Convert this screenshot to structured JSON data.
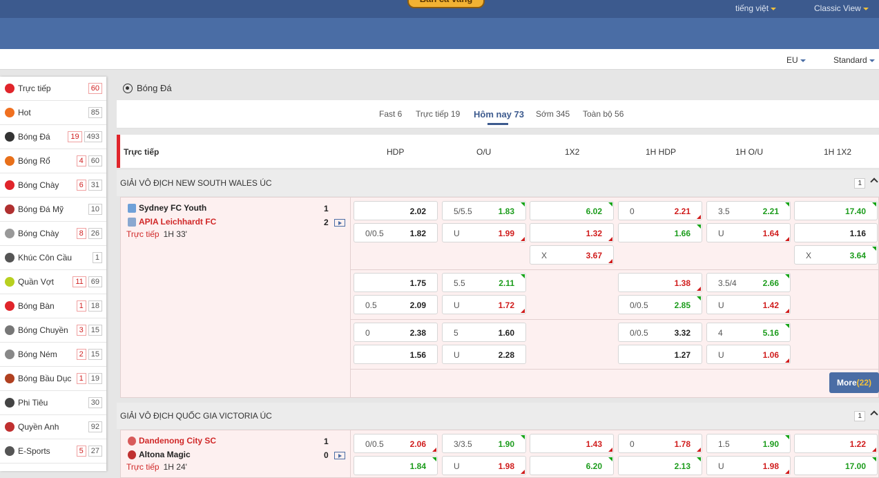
{
  "topbar": {
    "logo_text": "Bắn cá vàng",
    "language": "tiếng việt",
    "view_mode": "Classic View"
  },
  "subbar": {
    "odds_format": "EU",
    "display_mode": "Standard"
  },
  "sidebar": {
    "items": [
      {
        "icon": "live-icon",
        "label": "Trực tiếp",
        "live": "",
        "count": "60",
        "count_red": true,
        "color": "#e0252b"
      },
      {
        "icon": "fire-icon",
        "label": "Hot",
        "live": "",
        "count": "85",
        "color": "#f07020"
      },
      {
        "icon": "soccer-ball-icon",
        "label": "Bóng Đá",
        "live": "19",
        "count": "493",
        "color": "#333333"
      },
      {
        "icon": "basketball-icon",
        "label": "Bóng Rổ",
        "live": "4",
        "count": "60",
        "color": "#e8701a"
      },
      {
        "icon": "baseball-icon",
        "label": "Bóng Chày",
        "live": "6",
        "count": "31",
        "color": "#e0252b"
      },
      {
        "icon": "american-football-icon",
        "label": "Bóng Đá Mỹ",
        "live": "",
        "count": "10",
        "color": "#b03030"
      },
      {
        "icon": "baseball-white-icon",
        "label": "Bóng Chày",
        "live": "8",
        "count": "26",
        "color": "#999999"
      },
      {
        "icon": "hockey-stick-icon",
        "label": "Khúc Côn Cầu",
        "live": "",
        "count": "1",
        "color": "#555555"
      },
      {
        "icon": "tennis-ball-icon",
        "label": "Quần Vợt",
        "live": "11",
        "count": "69",
        "color": "#b8d020"
      },
      {
        "icon": "table-tennis-icon",
        "label": "Bóng Bàn",
        "live": "1",
        "count": "18",
        "color": "#e0252b"
      },
      {
        "icon": "volleyball-icon",
        "label": "Bóng Chuyền",
        "live": "3",
        "count": "15",
        "color": "#777777"
      },
      {
        "icon": "handball-icon",
        "label": "Bóng Ném",
        "live": "2",
        "count": "15",
        "color": "#888888"
      },
      {
        "icon": "rugby-ball-icon",
        "label": "Bóng Bầu Dục",
        "live": "1",
        "count": "19",
        "color": "#b04020"
      },
      {
        "icon": "darts-icon",
        "label": "Phi Tiêu",
        "live": "",
        "count": "30",
        "color": "#444444"
      },
      {
        "icon": "boxing-glove-icon",
        "label": "Quyền Anh",
        "live": "",
        "count": "92",
        "color": "#c03030"
      },
      {
        "icon": "gamepad-icon",
        "label": "E-Sports",
        "live": "5",
        "count": "27",
        "color": "#555555"
      }
    ]
  },
  "main": {
    "sport_title": "Bóng Đá",
    "tabs": [
      "Fast 6",
      "Trực tiếp 19",
      "Hôm nay 73",
      "Sớm 345",
      "Toàn bộ 56"
    ],
    "header": {
      "section": "Trực tiếp",
      "columns": [
        "HDP",
        "O/U",
        "1X2",
        "1H HDP",
        "1H O/U",
        "1H 1X2"
      ]
    },
    "leagues": [
      {
        "name": "GIẢI VÔ ĐỊCH NEW SOUTH WALES ÚC",
        "count": "1",
        "match": {
          "home": "Sydney FC Youth",
          "away": "APIA Leichhardt FC",
          "home_score": "1",
          "away_score": "2",
          "status": "Trực tiếp",
          "time": "1H 33'",
          "more": "More",
          "more_count": "(22)"
        }
      },
      {
        "name": "GIẢI VÔ ĐỊCH QUỐC GIA VICTORIA ÚC",
        "count": "1",
        "match": {
          "home": "Dandenong City SC",
          "away": "Altona Magic",
          "home_score": "1",
          "away_score": "0",
          "status": "Trực tiếp",
          "time": "1H 24'"
        }
      }
    ],
    "odds": [
      [
        "",
        "2.02",
        "k",
        "",
        "5/5.5",
        "1.83",
        "g",
        "up",
        "",
        "6.02",
        "g",
        "up",
        "0",
        "2.21",
        "r",
        "dn",
        "3.5",
        "2.21",
        "g",
        "up",
        "",
        "17.40",
        "g",
        "up"
      ],
      [
        "0/0.5",
        "1.82",
        "k",
        "",
        "U",
        "1.99",
        "r",
        "dn",
        "",
        "1.32",
        "r",
        "dn",
        "",
        "1.66",
        "g",
        "up",
        "U",
        "1.64",
        "r",
        "dn",
        "",
        "1.16",
        "k",
        ""
      ],
      [
        "",
        "",
        "",
        "",
        "",
        "",
        "",
        "",
        "X",
        "3.67",
        "r",
        "dn",
        "",
        "",
        "",
        "",
        "",
        "",
        "",
        "",
        "X",
        "3.64",
        "g",
        "up"
      ],
      [
        "",
        "1.75",
        "k",
        "",
        "5.5",
        "2.11",
        "g",
        "up",
        "",
        "",
        "",
        "",
        "",
        "1.38",
        "r",
        "dn",
        "3.5/4",
        "2.66",
        "g",
        "up",
        "",
        "",
        "",
        ""
      ],
      [
        "0.5",
        "2.09",
        "k",
        "",
        "U",
        "1.72",
        "r",
        "dn",
        "",
        "",
        "",
        "",
        "0/0.5",
        "2.85",
        "g",
        "up",
        "U",
        "1.42",
        "r",
        "dn",
        "",
        "",
        "",
        ""
      ],
      [
        "0",
        "2.38",
        "k",
        "",
        "5",
        "1.60",
        "k",
        "",
        "",
        "",
        "",
        "",
        "0/0.5",
        "3.32",
        "k",
        "",
        "4",
        "5.16",
        "g",
        "up",
        "",
        "",
        "",
        ""
      ],
      [
        "",
        "1.56",
        "k",
        "",
        "U",
        "2.28",
        "k",
        "",
        "",
        "",
        "",
        "",
        "",
        "1.27",
        "k",
        "",
        "U",
        "1.06",
        "r",
        "dn",
        "",
        "",
        "",
        ""
      ],
      [
        "0/0.5",
        "2.06",
        "r",
        "dn",
        "3/3.5",
        "1.90",
        "g",
        "up",
        "",
        "1.43",
        "r",
        "dn",
        "0",
        "1.78",
        "r",
        "dn",
        "1.5",
        "1.90",
        "g",
        "up",
        "",
        "1.22",
        "r",
        "dn"
      ],
      [
        "",
        "1.84",
        "g",
        "up",
        "U",
        "1.98",
        "r",
        "dn",
        "",
        "6.20",
        "g",
        "up",
        "",
        "2.13",
        "g",
        "up",
        "U",
        "1.98",
        "r",
        "dn",
        "",
        "17.00",
        "g",
        "up"
      ]
    ]
  }
}
